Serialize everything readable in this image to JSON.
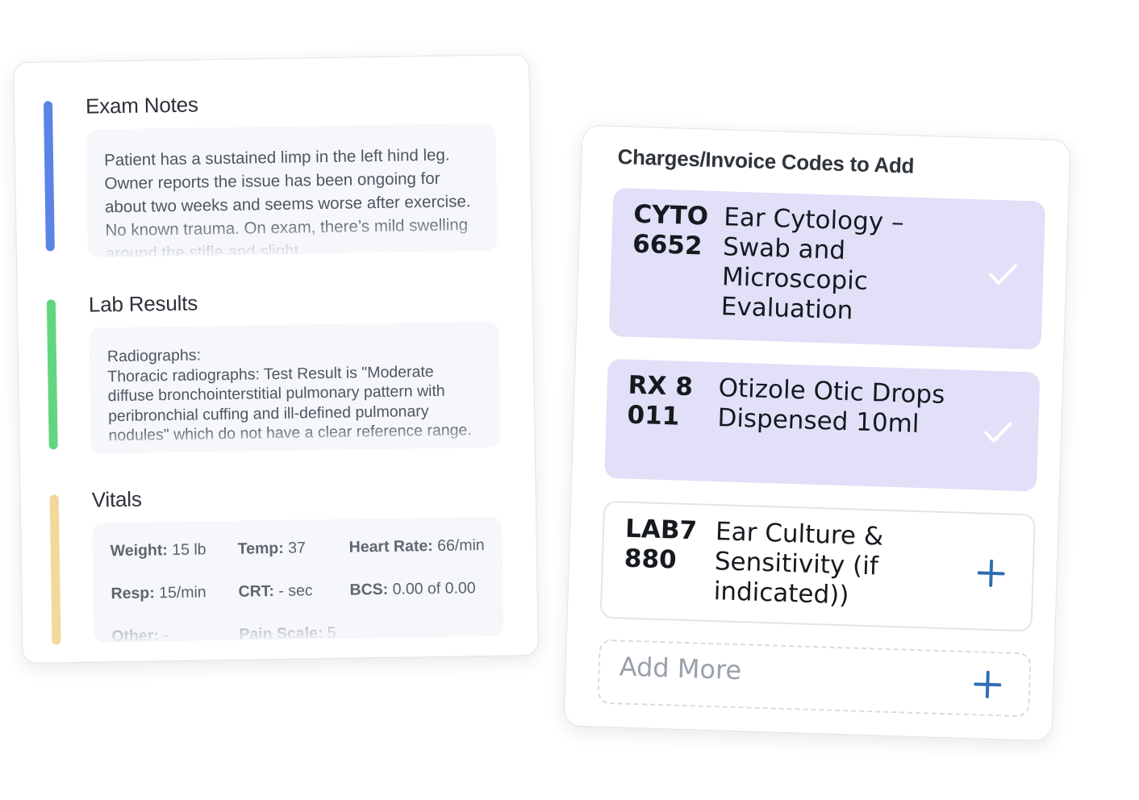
{
  "exam_notes": {
    "title": "Exam Notes",
    "accent_color": "#5b84e6",
    "text": "Patient has a sustained limp in the left hind leg. Owner reports the issue has been ongoing for about two weeks and seems worse after exercise. No known trauma. On exam, there’s mild swelling around the stifle and slight"
  },
  "lab_results": {
    "title": "Lab Results",
    "accent_color": "#62d67f",
    "heading": "Radiographs:",
    "text": "Thoracic radiographs: Test Result is \"Moderate diffuse bronchointerstitial pulmonary pattern with peribronchial cuffing and ill-defined pulmonary nodules\" which do not have a clear reference range."
  },
  "vitals": {
    "title": "Vitals",
    "accent_color": "#f3d79b",
    "items": [
      {
        "label": "Weight:",
        "value": "15 lb"
      },
      {
        "label": "Temp:",
        "value": "37"
      },
      {
        "label": "Heart Rate:",
        "value": "66/min"
      },
      {
        "label": "Resp:",
        "value": "15/min"
      },
      {
        "label": "CRT:",
        "value": "- sec"
      },
      {
        "label": "BCS:",
        "value": "0.00 of 0.00"
      },
      {
        "label": "Other:",
        "value": "-"
      },
      {
        "label": "Pain Scale:",
        "value": "5"
      }
    ]
  },
  "charges": {
    "title": "Charges/Invoice Codes to Add",
    "selected_color": "#e1e0f8",
    "add_icon_color": "#2f6db3",
    "items": [
      {
        "code": "CYTO 6652",
        "description": "Ear Cytology – Swab and Microscopic Evaluation",
        "state": "selected",
        "icon": "check-icon"
      },
      {
        "code": "RX 8011",
        "description": "Otizole Otic Drops Dispensed 10ml",
        "state": "selected",
        "icon": "check-icon"
      },
      {
        "code": "LAB7 880",
        "description": "Ear Culture & Sensitivity (if indicated))",
        "state": "unselected",
        "icon": "plus-icon"
      }
    ],
    "add_more_label": "Add More"
  }
}
